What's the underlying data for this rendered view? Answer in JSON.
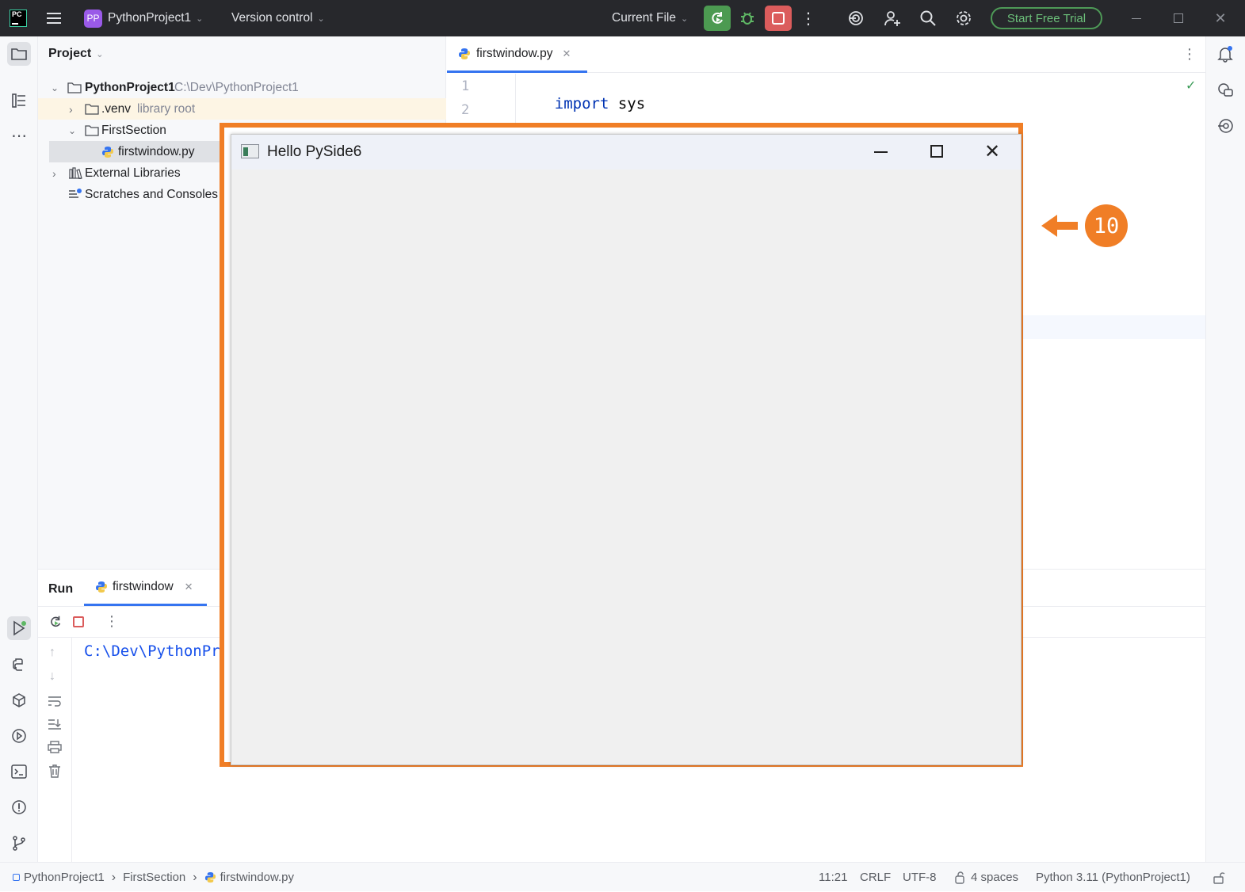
{
  "titlebar": {
    "logo": "PC",
    "project_badge": "PP",
    "project_name": "PythonProject1",
    "version_control": "Version control",
    "run_config": "Current File",
    "trial_button": "Start Free Trial",
    "icons": [
      "menu-icon",
      "rerun-icon",
      "debug-icon",
      "stop-icon",
      "more-icon",
      "ai-icon",
      "add-user-icon",
      "search-icon",
      "gear-icon"
    ]
  },
  "project_panel": {
    "title": "Project",
    "tree": [
      {
        "label": "PythonProject1",
        "extra": "C:\\Dev\\PythonProject1"
      },
      {
        "label": ".venv",
        "extra": "library root"
      },
      {
        "label": "FirstSection",
        "extra": ""
      },
      {
        "label": "firstwindow.py",
        "extra": ""
      },
      {
        "label": "External Libraries",
        "extra": ""
      },
      {
        "label": "Scratches and Consoles",
        "extra": ""
      }
    ]
  },
  "editor": {
    "tab_label": "firstwindow.py",
    "line_numbers": [
      "1",
      "2"
    ],
    "code_keyword": "import",
    "code_rest": " sys"
  },
  "run_panel": {
    "title": "Run",
    "tab_label": "firstwindow",
    "output": "C:\\Dev\\PythonPr"
  },
  "qt_window": {
    "title": "Hello PySide6"
  },
  "annotation": {
    "step_number": "10",
    "color": "#f07e26"
  },
  "statusbar": {
    "breadcrumb": [
      "PythonProject1",
      "FirstSection",
      "firstwindow.py"
    ],
    "position": "11:21",
    "line_ending": "CRLF",
    "encoding": "UTF-8",
    "indent": "4 spaces",
    "interpreter": "Python 3.11 (PythonProject1)"
  }
}
